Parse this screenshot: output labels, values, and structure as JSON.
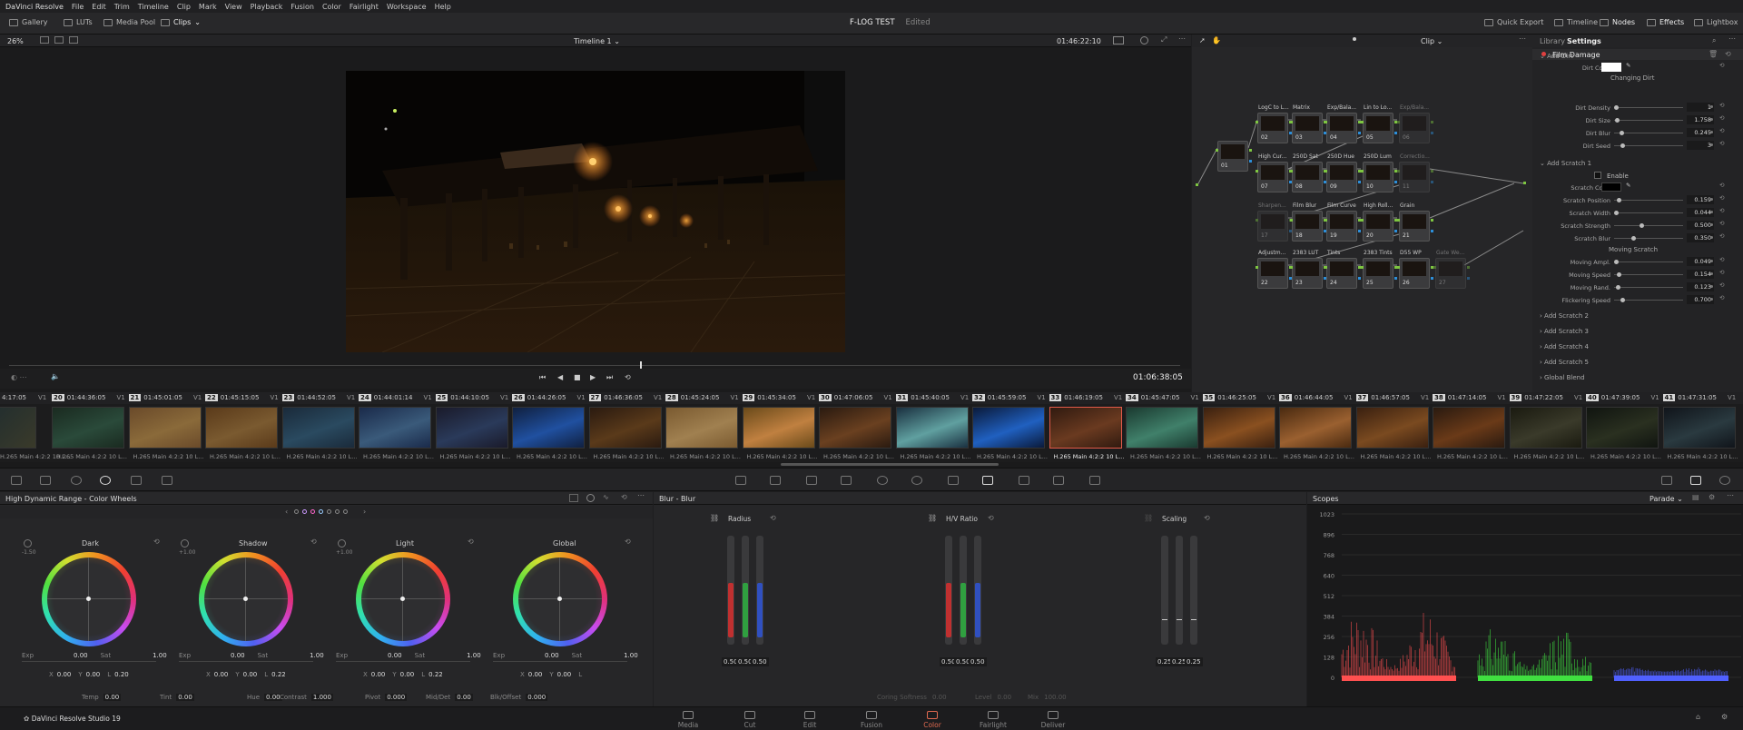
{
  "menu": [
    "DaVinci Resolve",
    "File",
    "Edit",
    "Trim",
    "Timeline",
    "Clip",
    "Mark",
    "View",
    "Playback",
    "Fusion",
    "Color",
    "Fairlight",
    "Workspace",
    "Help"
  ],
  "toolbar": {
    "gallery": "Gallery",
    "luts": "LUTs",
    "media_pool": "Media Pool",
    "clips": "Clips",
    "project_title": "F-LOG TEST",
    "project_status": "Edited",
    "quick_export": "Quick Export",
    "timeline": "Timeline",
    "nodes": "Nodes",
    "effects": "Effects",
    "lightbox": "Lightbox"
  },
  "viewer": {
    "zoom": "26%",
    "timeline_name": "Timeline 1",
    "timecode_top": "01:46:22:10",
    "timecode_bottom": "01:06:38:05"
  },
  "nodes_bar": {
    "mode": "Clip"
  },
  "fx": {
    "tab_library": "Library",
    "tab_settings": "Settings",
    "effect_name": "Film Damage",
    "add_dirt": "Add Dirt",
    "dirt_color": "Dirt Color",
    "changing_dirt": "Changing Dirt",
    "dirt_rows": [
      {
        "label": "Dirt Density",
        "value": "1",
        "pos": 0.02
      },
      {
        "label": "Dirt Size",
        "value": "1.758",
        "pos": 0.04
      },
      {
        "label": "Dirt Blur",
        "value": "0.245",
        "pos": 0.1
      },
      {
        "label": "Dirt Seed",
        "value": "3",
        "pos": 0.12
      }
    ],
    "add_scratch1": "Add Scratch 1",
    "enable": "Enable",
    "scratch_color": "Scratch Color",
    "scratch_rows": [
      {
        "label": "Scratch Position",
        "value": "0.159",
        "pos": 0.07
      },
      {
        "label": "Scratch Width",
        "value": "0.044",
        "pos": 0.02
      },
      {
        "label": "Scratch Strength",
        "value": "0.500",
        "pos": 0.4
      },
      {
        "label": "Scratch Blur",
        "value": "0.350",
        "pos": 0.28
      }
    ],
    "moving_scratch": "Moving Scratch",
    "moving_rows": [
      {
        "label": "Moving Ampl.",
        "value": "0.049",
        "pos": 0.02
      },
      {
        "label": "Moving Speed",
        "value": "0.154",
        "pos": 0.06
      },
      {
        "label": "Moving Rand.",
        "value": "0.123",
        "pos": 0.05
      },
      {
        "label": "Flickering Speed",
        "value": "0.700",
        "pos": 0.12
      }
    ],
    "sections": [
      "Add Scratch 2",
      "Add Scratch 3",
      "Add Scratch 4",
      "Add Scratch 5",
      "Global Blend"
    ]
  },
  "nodes": [
    {
      "label": "",
      "num": "01"
    },
    {
      "label": "LogC to L...",
      "num": "02"
    },
    {
      "label": "Matrix",
      "num": "03"
    },
    {
      "label": "Exp/Bala...",
      "num": "04"
    },
    {
      "label": "Lin to Lo...",
      "num": "05"
    },
    {
      "label": "Exp/Bala...",
      "num": "06"
    },
    {
      "label": "High Cur...",
      "num": "07"
    },
    {
      "label": "250D Sat",
      "num": "08"
    },
    {
      "label": "250D Hue",
      "num": "09"
    },
    {
      "label": "250D Lum",
      "num": "10"
    },
    {
      "label": "Correctio...",
      "num": "11"
    },
    {
      "label": "Sharpen...",
      "num": "17"
    },
    {
      "label": "Film Blur",
      "num": "18"
    },
    {
      "label": "Film Curve",
      "num": "19"
    },
    {
      "label": "High Roll...",
      "num": "20"
    },
    {
      "label": "Grain",
      "num": "21"
    },
    {
      "label": "Adjustm...",
      "num": "22"
    },
    {
      "label": "2383 LUT",
      "num": "23"
    },
    {
      "label": "Tints",
      "num": "24"
    },
    {
      "label": "2383 Tints",
      "num": "25"
    },
    {
      "label": "D55 WP",
      "num": "26"
    },
    {
      "label": "Gate We...",
      "num": "27"
    }
  ],
  "clips": [
    {
      "num": "20",
      "tc": "01:44:36:05",
      "cap": "H.265 Main 4:2:2 10 L..."
    },
    {
      "num": "21",
      "tc": "01:45:01:05",
      "cap": "H.265 Main 4:2:2 10 L..."
    },
    {
      "num": "22",
      "tc": "01:45:15:05",
      "cap": "H.265 Main 4:2:2 10 L..."
    },
    {
      "num": "23",
      "tc": "01:44:52:05",
      "cap": "H.265 Main 4:2:2 10 L..."
    },
    {
      "num": "24",
      "tc": "01:44:01:14",
      "cap": "H.265 Main 4:2:2 10 L..."
    },
    {
      "num": "25",
      "tc": "01:44:10:05",
      "cap": "H.265 Main 4:2:2 10 L..."
    },
    {
      "num": "26",
      "tc": "01:44:26:05",
      "cap": "H.265 Main 4:2:2 10 L..."
    },
    {
      "num": "27",
      "tc": "01:46:36:05",
      "cap": "H.265 Main 4:2:2 10 L..."
    },
    {
      "num": "28",
      "tc": "01:45:24:05",
      "cap": "H.265 Main 4:2:2 10 L..."
    },
    {
      "num": "29",
      "tc": "01:45:34:05",
      "cap": "H.265 Main 4:2:2 10 L..."
    },
    {
      "num": "30",
      "tc": "01:47:06:05",
      "cap": "H.265 Main 4:2:2 10 L..."
    },
    {
      "num": "31",
      "tc": "01:45:40:05",
      "cap": "H.265 Main 4:2:2 10 L..."
    },
    {
      "num": "32",
      "tc": "01:45:59:05",
      "cap": "H.265 Main 4:2:2 10 L..."
    },
    {
      "num": "33",
      "tc": "01:46:19:05",
      "cap": "H.265 Main 4:2:2 10 L..."
    },
    {
      "num": "34",
      "tc": "01:45:47:05",
      "cap": "H.265 Main 4:2:2 10 L..."
    },
    {
      "num": "35",
      "tc": "01:46:25:05",
      "cap": "H.265 Main 4:2:2 10 L..."
    },
    {
      "num": "36",
      "tc": "01:46:44:05",
      "cap": "H.265 Main 4:2:2 10 L..."
    },
    {
      "num": "37",
      "tc": "01:46:57:05",
      "cap": "H.265 Main 4:2:2 10 L..."
    },
    {
      "num": "38",
      "tc": "01:47:14:05",
      "cap": "H.265 Main 4:2:2 10 L..."
    },
    {
      "num": "39",
      "tc": "01:47:22:05",
      "cap": "H.265 Main 4:2:2 10 L..."
    },
    {
      "num": "40",
      "tc": "01:47:39:05",
      "cap": "H.265 Main 4:2:2 10 L..."
    },
    {
      "num": "41",
      "tc": "01:47:31:05",
      "cap": "H.265 Main 4:2:2 10 L..."
    }
  ],
  "first_tc": "4:17:05",
  "track": "V1",
  "wheels_panel": {
    "title": "High Dynamic Range - Color Wheels",
    "wheels": [
      {
        "name": "Dark",
        "knob": "-1.50",
        "exp": "0.00",
        "sat": "1.00",
        "x": "0.00",
        "y": "0.00",
        "z": "0.20"
      },
      {
        "name": "Shadow",
        "knob": "+1.00",
        "exp": "0.00",
        "sat": "1.00",
        "x": "0.00",
        "y": "0.00",
        "z": "0.22"
      },
      {
        "name": "Light",
        "knob": "+1.00",
        "exp": "0.00",
        "sat": "1.00",
        "x": "0.00",
        "y": "0.00",
        "z": "0.22"
      },
      {
        "name": "Global",
        "knob": "",
        "exp": "0.00",
        "sat": "1.00",
        "x": "0.00",
        "y": "0.00",
        "z": ""
      }
    ],
    "footer": [
      {
        "label": "Temp",
        "value": "0.00"
      },
      {
        "label": "Tint",
        "value": "0.00"
      },
      {
        "label": "Hue",
        "value": "0.00"
      },
      {
        "label": "Contrast",
        "value": "1.000"
      },
      {
        "label": "Pivot",
        "value": "0.000"
      },
      {
        "label": "Mid/Det",
        "value": "0.00"
      },
      {
        "label": "Blk/Offset",
        "value": "0.000"
      }
    ]
  },
  "blur_panel": {
    "title": "Blur - Blur",
    "groups": [
      {
        "name": "Radius",
        "values": [
          "0.50",
          "0.50",
          "0.50"
        ]
      },
      {
        "name": "H/V Ratio",
        "values": [
          "0.50",
          "0.50",
          "0.50"
        ]
      },
      {
        "name": "Scaling",
        "values": [
          "0.25",
          "0.25",
          "0.25"
        ]
      }
    ],
    "footer": [
      {
        "label": "Coring Softness",
        "value": "0.00"
      },
      {
        "label": "Level",
        "value": "0.00"
      },
      {
        "label": "Mix",
        "value": "100.00"
      }
    ]
  },
  "scopes": {
    "title": "Scopes",
    "mode": "Parade",
    "ticks": [
      "1023",
      "896",
      "768",
      "640",
      "512",
      "384",
      "256",
      "128",
      "0"
    ]
  },
  "bottom": {
    "app": "DaVinci Resolve Studio 19",
    "pages": [
      "Media",
      "Cut",
      "Edit",
      "Fusion",
      "Color",
      "Fairlight",
      "Deliver"
    ],
    "active": "Color"
  },
  "colors": {
    "accent": "#e06a50",
    "selected_clip": "#e25a4a"
  }
}
